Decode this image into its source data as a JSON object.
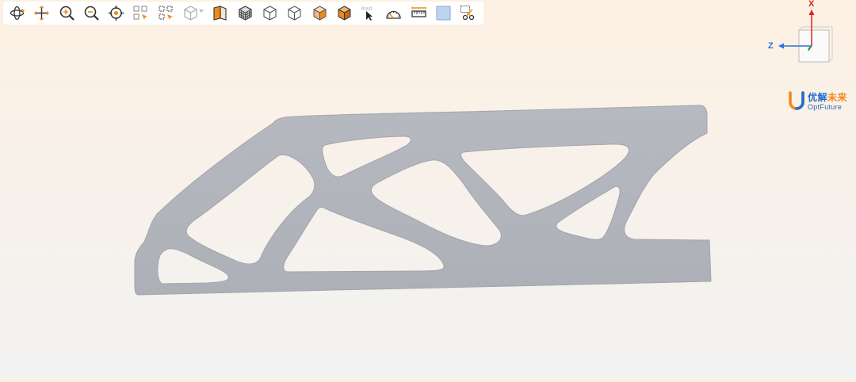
{
  "toolbar": {
    "buttons": [
      {
        "name": "rotate-icon"
      },
      {
        "name": "pan-icon"
      },
      {
        "name": "zoom-in-icon"
      },
      {
        "name": "zoom-out-icon"
      },
      {
        "name": "fit-target-icon"
      },
      {
        "name": "select-region-icon"
      },
      {
        "name": "deselect-region-icon"
      },
      {
        "name": "view-cube-dropdown-icon"
      },
      {
        "name": "section-plane-icon"
      },
      {
        "name": "mesh-view-icon"
      },
      {
        "name": "wireframe-view-icon"
      },
      {
        "name": "hidden-line-view-icon"
      },
      {
        "name": "shaded-edges-view-icon"
      },
      {
        "name": "shaded-view-icon"
      },
      {
        "name": "pick-point-icon"
      },
      {
        "name": "angle-measure-icon"
      },
      {
        "name": "distance-measure-icon"
      },
      {
        "name": "background-color-icon"
      },
      {
        "name": "cut-select-icon"
      }
    ],
    "accent_color": "#f08a1c"
  },
  "axes": {
    "x_label": "X",
    "z_label": "Z",
    "x_color": "#e02020",
    "z_color": "#2f6fe0",
    "y_color": "#1aa34a"
  },
  "logo": {
    "cn_part1": "优解",
    "cn_part2": "未来",
    "en": "OptFuture"
  },
  "model": {
    "color": "#b3b6bd"
  }
}
